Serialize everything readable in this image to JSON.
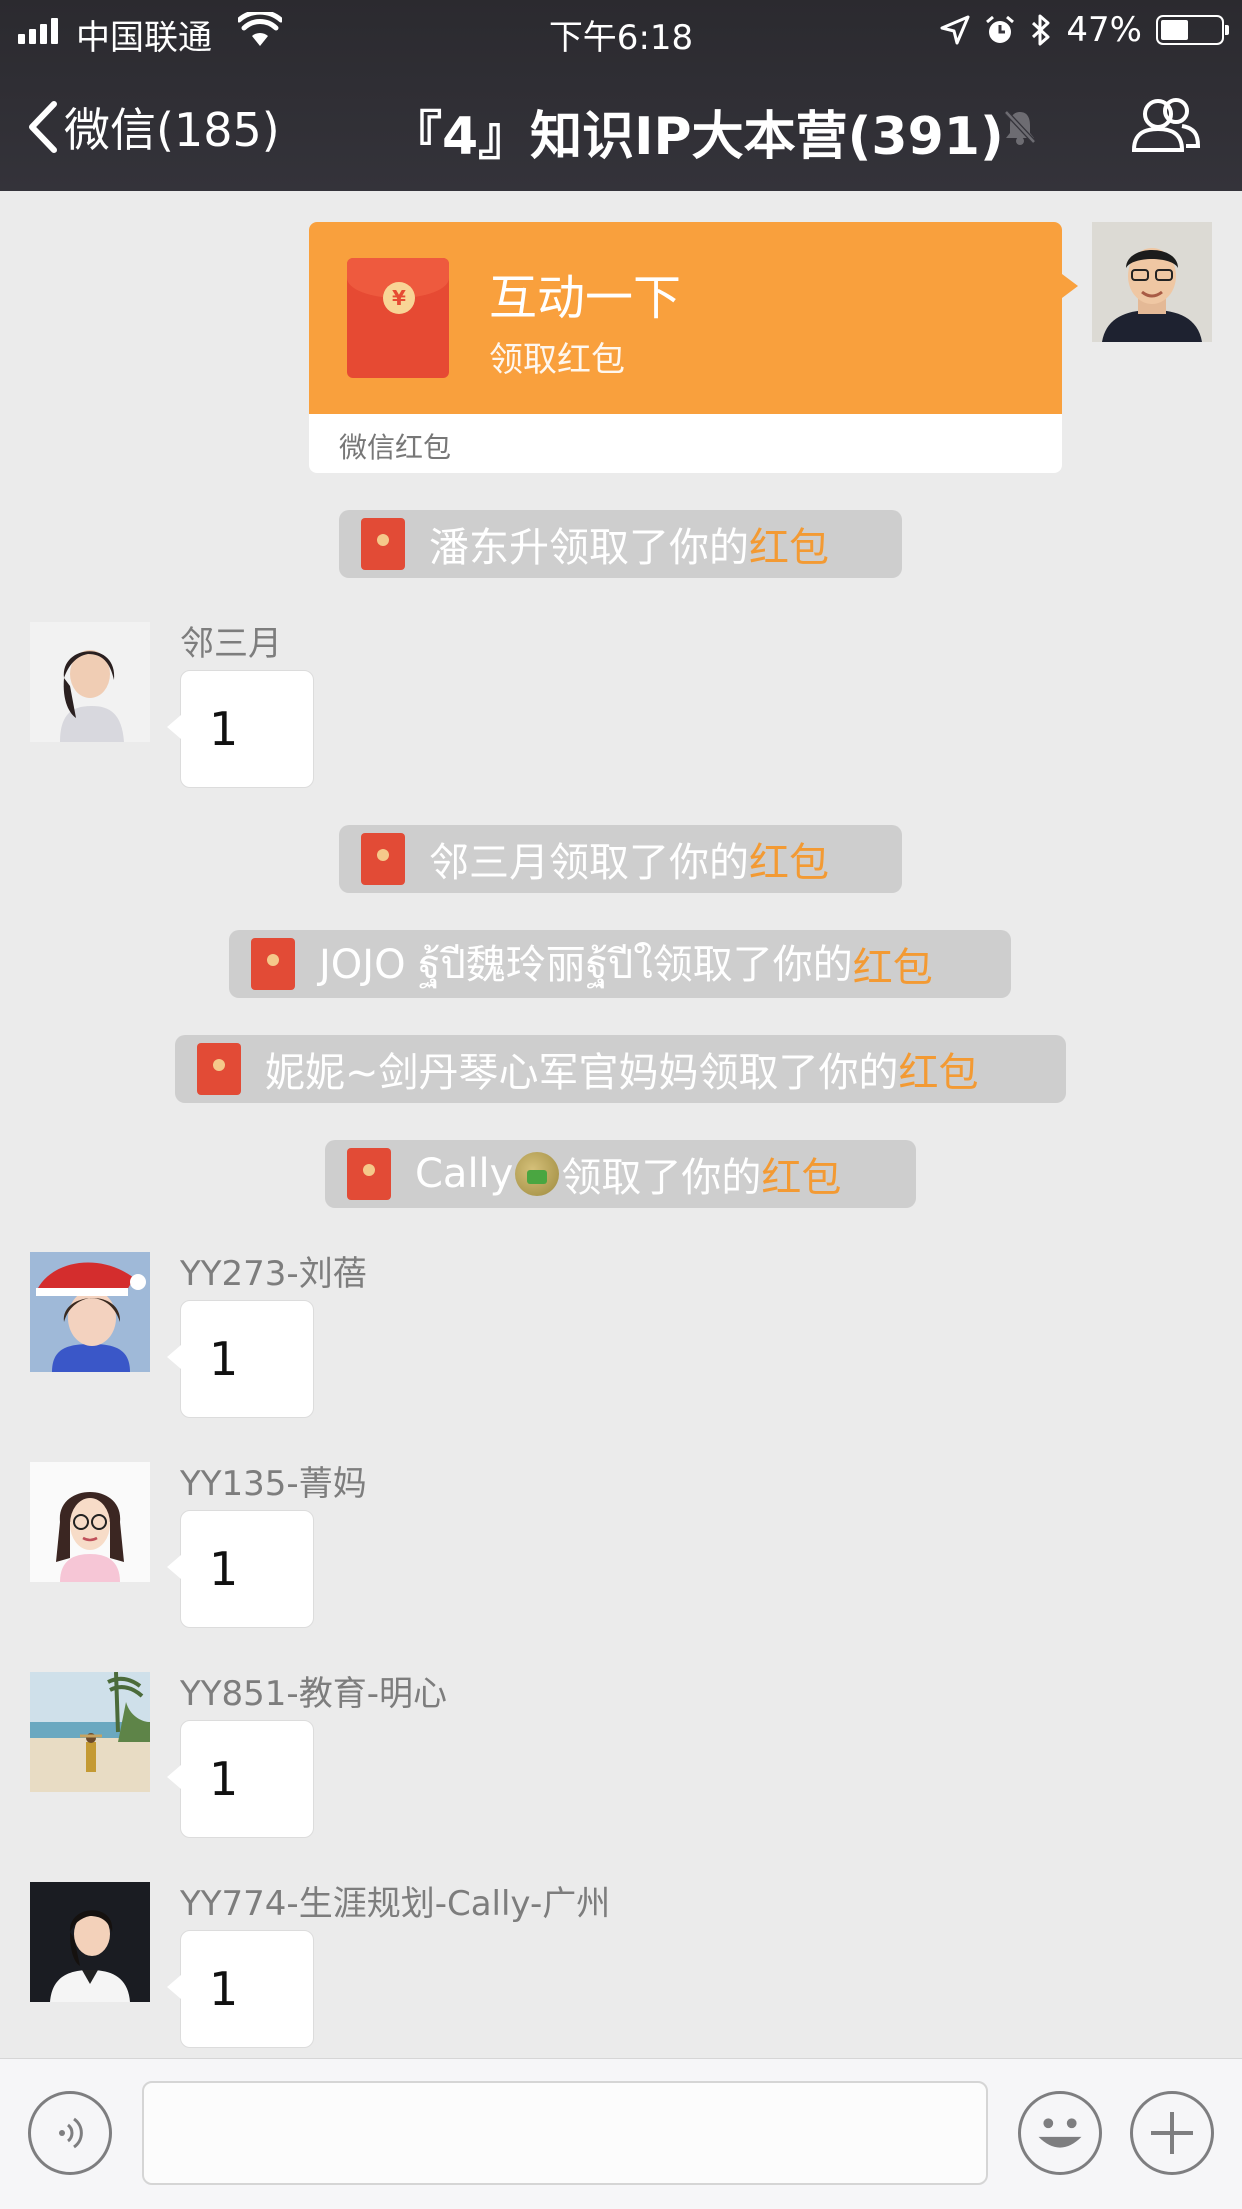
{
  "status_bar": {
    "carrier": "中国联通",
    "time": "下午6:18",
    "battery_percent": "47%",
    "battery_level": 0.47,
    "icons": [
      "signal-icon",
      "wifi-icon",
      "location-icon",
      "alarm-icon",
      "bluetooth-icon",
      "battery-icon"
    ]
  },
  "nav": {
    "back_label": "微信(185)",
    "title": "『4』知识IP大本营(391)",
    "icons": [
      "chevron-left-icon",
      "mute-bell-icon",
      "group-members-icon"
    ]
  },
  "red_packet": {
    "title": "互动一下",
    "subtitle": "领取红包",
    "footer": "微信红包",
    "color": "#f9a03d"
  },
  "system_messages": [
    {
      "prefix": "潘东升领取了你的",
      "link": "红包"
    },
    {
      "prefix": "邻三月领取了你的",
      "link": "红包"
    },
    {
      "prefix": "JOJO ฐ้ปี魏玲丽ฐ้ปีใ领取了你的",
      "link": "红包"
    },
    {
      "prefix": "妮妮~剑丹琴心军官妈妈领取了你的",
      "link": "红包"
    },
    {
      "prefix_a": "Cally",
      "prefix_b": "领取了你的",
      "link": "红包"
    }
  ],
  "messages": [
    {
      "sender": "邻三月",
      "text": "1"
    },
    {
      "sender": "YY273-刘蓓",
      "text": "1"
    },
    {
      "sender": "YY135-菁妈",
      "text": "1"
    },
    {
      "sender": "YY851-教育-明心",
      "text": "1"
    },
    {
      "sender": "YY774-生涯规划-Cally-广州",
      "text": "1"
    }
  ],
  "input_bar": {
    "placeholder": "",
    "icons": [
      "voice-icon",
      "emoji-icon",
      "plus-icon"
    ]
  }
}
